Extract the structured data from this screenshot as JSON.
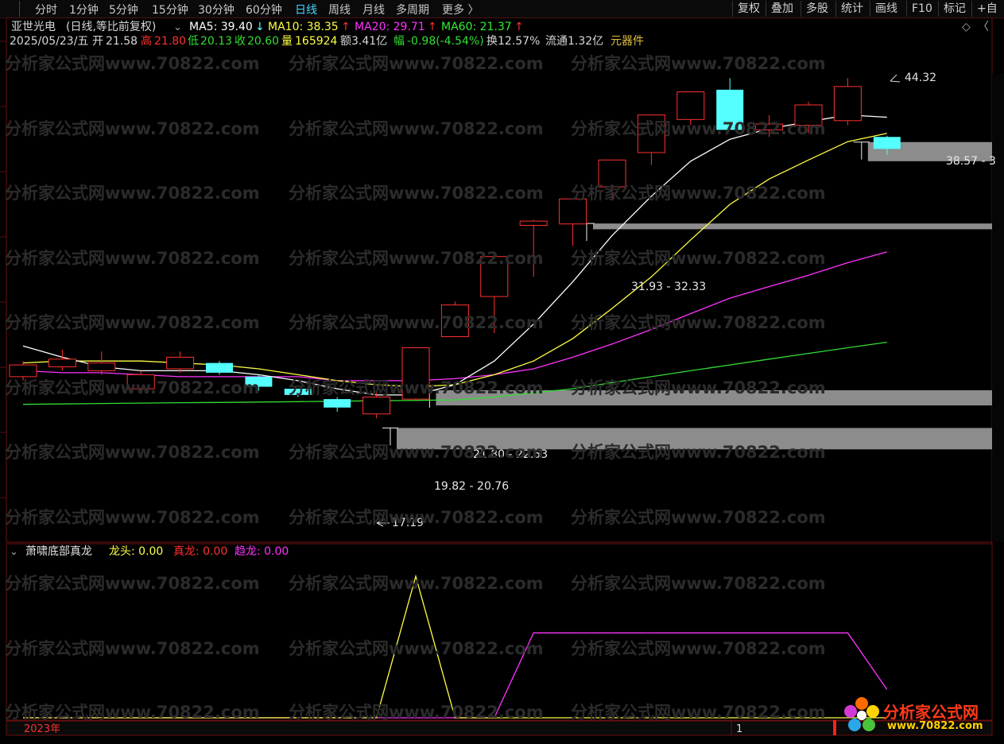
{
  "toolbar": {
    "tabs": [
      {
        "label": "分时",
        "active": false
      },
      {
        "label": "1分钟",
        "active": false
      },
      {
        "label": "5分钟",
        "active": false
      },
      {
        "label": "15分钟",
        "active": false
      },
      {
        "label": "30分钟",
        "active": false
      },
      {
        "label": "60分钟",
        "active": false
      },
      {
        "label": "日线",
        "active": true
      },
      {
        "label": "周线",
        "active": false
      },
      {
        "label": "月线",
        "active": false
      },
      {
        "label": "多周期",
        "active": false
      },
      {
        "label": "更多 〉",
        "active": false
      }
    ],
    "right_buttons": [
      "复权",
      "叠加",
      "多股",
      "统计",
      "画线",
      "F10",
      "标记",
      "+自"
    ]
  },
  "header": {
    "stock_name": "亚世光电",
    "mode": "(日线,等比前复权)",
    "ma5": "MA5: 39.40",
    "ma10": "MA10: 38.35",
    "ma20": "MA20: 29.71",
    "ma60": "MA60: 21.37",
    "down_arrow": "↓",
    "up_arrow": "↑",
    "date": "2025/05/23/五",
    "open_label": "开",
    "open": "21.58",
    "high_label": "高",
    "high": "21.80",
    "low_label": "低",
    "low": "20.13",
    "close_label": "收",
    "close": "20.60",
    "volume_label": "量",
    "volume": "165924",
    "amount": "额3.41亿",
    "change_label": "幅",
    "change": "-0.98(-4.54%)",
    "turnover": "换12.57%",
    "float": "流通1.32亿",
    "sector": "元器件"
  },
  "annotations": {
    "high_mark": "44.32",
    "low_mark": "17.19",
    "zone1": "31.93 - 32.33",
    "zone2": "21.80 - 22.53",
    "zone3": "19.82 - 20.76",
    "zone4": "38.57 - 3"
  },
  "indicator": {
    "name": "萧啸底部真龙",
    "l1": "龙头: 0.00",
    "l2": "真龙: 0.00",
    "l3": "趋龙: 0.00"
  },
  "footer": {
    "year": "2023年",
    "page": "1"
  },
  "watermark": "分析家公式网www.70822.com",
  "logo": {
    "name": "分析家公式网",
    "url": "www.70822.com"
  },
  "colors": {
    "up": "#ff3030",
    "down": "#54ffff",
    "ma5": "#ffffff",
    "ma10": "#ffff44",
    "ma20": "#ff33ff",
    "ma60": "#33dd33",
    "zone": "#8c8c8c"
  },
  "chart_data": {
    "type": "candlestick",
    "candles": [
      {
        "o": 23.2,
        "c": 23.8,
        "h": 24.0,
        "l": 23.0
      },
      {
        "o": 23.7,
        "c": 24.1,
        "h": 24.6,
        "l": 23.5
      },
      {
        "o": 23.5,
        "c": 23.9,
        "h": 24.5,
        "l": 23.3
      },
      {
        "o": 22.6,
        "c": 23.3,
        "h": 23.5,
        "l": 22.5
      },
      {
        "o": 23.6,
        "c": 24.2,
        "h": 24.5,
        "l": 23.4
      },
      {
        "o": 23.9,
        "c": 23.4,
        "h": 24.0,
        "l": 23.3
      },
      {
        "o": 23.2,
        "c": 22.7,
        "h": 23.3,
        "l": 22.5
      },
      {
        "o": 22.6,
        "c": 22.3,
        "h": 22.6,
        "l": 22.2
      },
      {
        "o": 22.1,
        "c": 21.7,
        "h": 22.2,
        "l": 21.5
      },
      {
        "o": 21.4,
        "c": 22.2,
        "h": 22.5,
        "l": 21.2
      },
      {
        "o": 22.1,
        "c": 24.7,
        "h": 24.7,
        "l": 22.0
      },
      {
        "o": 25.3,
        "c": 27.1,
        "h": 27.3,
        "l": 25.3
      },
      {
        "o": 27.6,
        "c": 30.1,
        "h": 30.2,
        "l": 25.5
      },
      {
        "o": 32.2,
        "c": 32.5,
        "h": 32.6,
        "l": 28.8
      },
      {
        "o": 32.3,
        "c": 34.1,
        "h": 34.1,
        "l": 30.8
      },
      {
        "o": 35.0,
        "c": 37.1,
        "h": 37.1,
        "l": 34.0
      },
      {
        "o": 37.7,
        "c": 40.9,
        "h": 40.9,
        "l": 36.7
      },
      {
        "o": 40.5,
        "c": 43.0,
        "h": 43.0,
        "l": 40.0
      },
      {
        "o": 43.2,
        "c": 39.6,
        "h": 44.3,
        "l": 39.6
      },
      {
        "o": 39.6,
        "c": 40.1,
        "h": 40.9,
        "l": 39.0
      },
      {
        "o": 40.0,
        "c": 41.8,
        "h": 42.1,
        "l": 39.3
      },
      {
        "o": 40.4,
        "c": 43.5,
        "h": 44.3,
        "l": 40.0
      },
      {
        "o": 39.0,
        "c": 38.0,
        "h": 39.1,
        "l": 37.5
      }
    ],
    "ma5": [
      24.8,
      24.2,
      23.7,
      23.5,
      23.5,
      23.5,
      23.3,
      23.0,
      22.6,
      22.3,
      22.3,
      22.8,
      24.0,
      26.0,
      28.5,
      31.5,
      34.3,
      37.0,
      38.8,
      39.7,
      40.3,
      40.9,
      40.7
    ],
    "ma10": [
      23.9,
      24.0,
      24.0,
      24.0,
      23.9,
      23.8,
      23.6,
      23.3,
      23.0,
      22.8,
      22.7,
      22.8,
      23.3,
      24.0,
      25.2,
      26.9,
      28.8,
      31.2,
      33.7,
      35.6,
      37.1,
      38.6,
      39.3
    ],
    "ma20": [
      23.5,
      23.4,
      23.4,
      23.3,
      23.2,
      23.2,
      23.2,
      23.2,
      23.0,
      23.0,
      23.0,
      23.1,
      23.3,
      23.6,
      24.2,
      24.9,
      25.7,
      26.6,
      27.5,
      28.2,
      28.9,
      29.7,
      30.4
    ],
    "ma60": [
      21.85,
      21.87,
      21.89,
      21.91,
      21.93,
      21.94,
      21.96,
      21.98,
      22.0,
      22.02,
      22.04,
      22.06,
      22.2,
      22.4,
      22.6,
      22.9,
      23.2,
      23.5,
      23.8,
      24.1,
      24.4,
      24.7,
      25.0
    ],
    "zones": [
      {
        "label": "31.93 - 32.33",
        "low": 31.93,
        "high": 32.33,
        "start": 15
      },
      {
        "label": "21.80 - 22.53",
        "low": 21.8,
        "high": 22.53,
        "start": 11
      },
      {
        "label": "19.82 - 20.76",
        "low": 19.82,
        "high": 20.76,
        "start": 10
      },
      {
        "label": "38.57 - 3",
        "low": 37.0,
        "high": 38.57,
        "start": 22
      }
    ],
    "ind_longtou": [
      0,
      0,
      0,
      0,
      0,
      0,
      0,
      0,
      0,
      0,
      1,
      0,
      0,
      0,
      0,
      0,
      0,
      0,
      0,
      0,
      0,
      0,
      0
    ],
    "ind_qulong": [
      0,
      0,
      0,
      0,
      0,
      0,
      0,
      0,
      0,
      0,
      0,
      0,
      0,
      0.6,
      0.6,
      0.6,
      0.6,
      0.6,
      0.6,
      0.6,
      0.6,
      0.6,
      0.2
    ]
  }
}
